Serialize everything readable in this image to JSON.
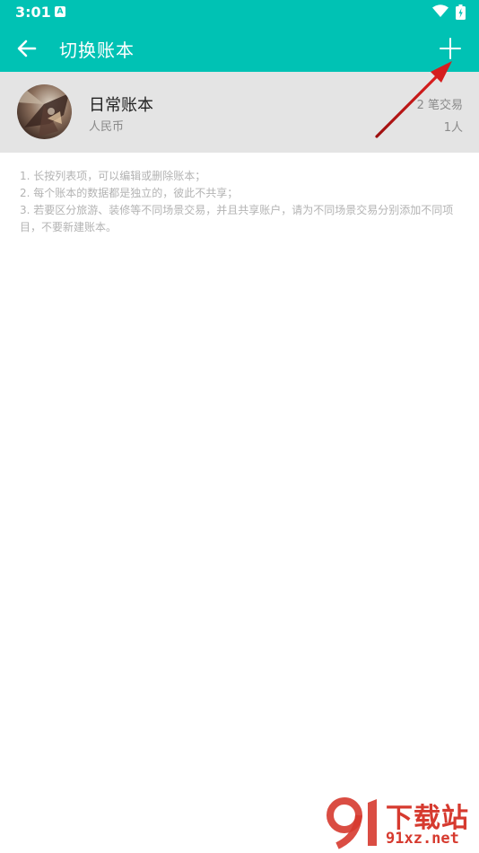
{
  "status_bar": {
    "time": "3:01",
    "notification_icon": "A",
    "icons": [
      "notification-a-icon",
      "wifi-icon",
      "battery-icon"
    ]
  },
  "app_bar": {
    "title": "切换账本",
    "back_icon": "arrow-left-icon",
    "add_icon": "plus-icon",
    "color": "#00c2b4"
  },
  "accounts": [
    {
      "name": "日常账本",
      "currency": "人民币",
      "transactions": "2 笔交易",
      "members": "1人"
    }
  ],
  "tips": [
    "1. 长按列表项，可以编辑或删除账本；",
    "2. 每个账本的数据都是独立的，彼此不共享；",
    "3. 若要区分旅游、装修等不同场景交易，并且共享账户，请为不同场景交易分别添加不同项目，不要新建账本。"
  ],
  "annotation": {
    "arrow_color": "#d51e1e"
  },
  "watermark": {
    "logo_text": "9",
    "title": "下载站",
    "url": "91xz.net"
  }
}
